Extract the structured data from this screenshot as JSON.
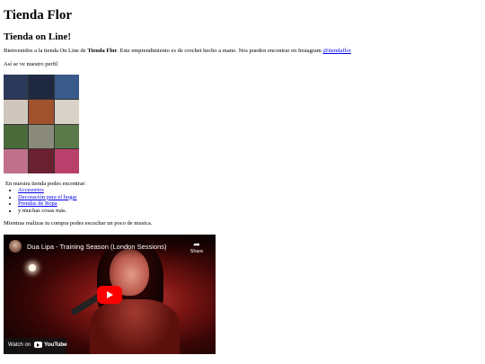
{
  "header": {
    "title": "Tienda Flor",
    "subtitle": "Tienda on Line!"
  },
  "intro": {
    "text_before": "Bienvenidos a la tienda On Line de ",
    "store_name": "Tienda Flor",
    "text_after": ". Este emprendimiento es de crochet hecho a mano. Nos pueden encontrar en Instagram ",
    "instagram_link": "@tiendaflor"
  },
  "profile": {
    "caption": "Así se ve nuestro perfil",
    "tiles": [
      {
        "color": "#2b3a5a"
      },
      {
        "color": "#1e2840"
      },
      {
        "color": "#3a5a8a"
      },
      {
        "color": "#cfc6bd"
      },
      {
        "color": "#a0522d"
      },
      {
        "color": "#d8d2c8"
      },
      {
        "color": "#4a6a3a"
      },
      {
        "color": "#8a8a7a"
      },
      {
        "color": "#5a7a4a"
      },
      {
        "color": "#c0708a"
      },
      {
        "color": "#6a2030"
      },
      {
        "color": "#b8406a"
      }
    ]
  },
  "catalog": {
    "intro": "En nuestra tienda podes encontrar:",
    "items": [
      {
        "label": "Accesorios",
        "link": true
      },
      {
        "label": "Decoración para el hogar",
        "link": true
      },
      {
        "label": "Prendas de Ropa",
        "link": true
      },
      {
        "label": "y muchas cosas más.",
        "link": false
      }
    ]
  },
  "music": {
    "caption": "Mientras realizas tu compra podes escuchar un poco de musica."
  },
  "video": {
    "title": "Dua Lipa - Training Season (London Sessions)",
    "share_label": "Share",
    "watch_on": "Watch on",
    "platform": "YouTube",
    "play_color": "#ff0000"
  }
}
